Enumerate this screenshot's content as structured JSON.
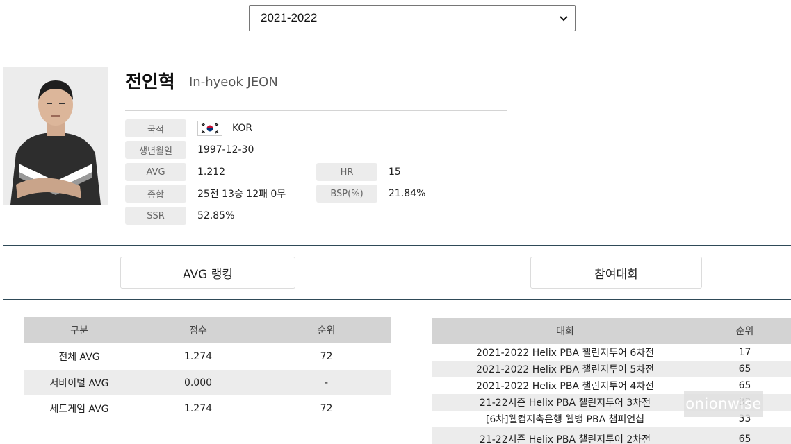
{
  "season_select": {
    "selected": "2021-2022"
  },
  "player": {
    "name_kr": "전인혁",
    "name_en": "In-hyeok JEON",
    "nationality_label": "국적",
    "nationality_value": "KOR",
    "birth_label": "생년월일",
    "birth_value": "1997-12-30",
    "avg_label": "AVG",
    "avg_value": "1.212",
    "hr_label": "HR",
    "hr_value": "15",
    "record_label": "종합",
    "record_value": "25전 13승 12패 0무",
    "bsp_label": "BSP(%)",
    "bsp_value": "21.84%",
    "ssr_label": "SSR",
    "ssr_value": "52.85%"
  },
  "tabs": {
    "avg_ranking": "AVG 랭킹",
    "tournaments": "참여대회"
  },
  "avg_table": {
    "headers": [
      "구분",
      "점수",
      "순위"
    ],
    "rows": [
      {
        "category": "전체 AVG",
        "score": "1.274",
        "rank": "72"
      },
      {
        "category": "서바이벌 AVG",
        "score": "0.000",
        "rank": "-"
      },
      {
        "category": "세트게임 AVG",
        "score": "1.274",
        "rank": "72"
      }
    ]
  },
  "tournament_table": {
    "headers": [
      "대회",
      "순위"
    ],
    "rows": [
      {
        "name": "2021-2022 Helix PBA 챌린지투어 6차전",
        "rank": "17"
      },
      {
        "name": "2021-2022 Helix PBA 챌린지투어 5차전",
        "rank": "65"
      },
      {
        "name": "2021-2022 Helix PBA 챌린지투어 4차전",
        "rank": "65"
      },
      {
        "name": "21-22시즌 Helix PBA 챌린지투어 3차전",
        "rank": "33"
      },
      {
        "name": "[6차]웰컴저축은행 웰뱅 PBA 챔피언십",
        "rank": "33"
      },
      {
        "name": "21-22시즌 Helix PBA 챌린지투어 2차전",
        "rank": "65"
      }
    ]
  },
  "watermark": "onionwise",
  "colors": {
    "rule": "#2f4a58",
    "header_bg": "#d3d3d3",
    "label_bg": "#ececec"
  },
  "icons": {
    "select": "chevron-down-icon",
    "flag": "korea-flag-icon"
  }
}
